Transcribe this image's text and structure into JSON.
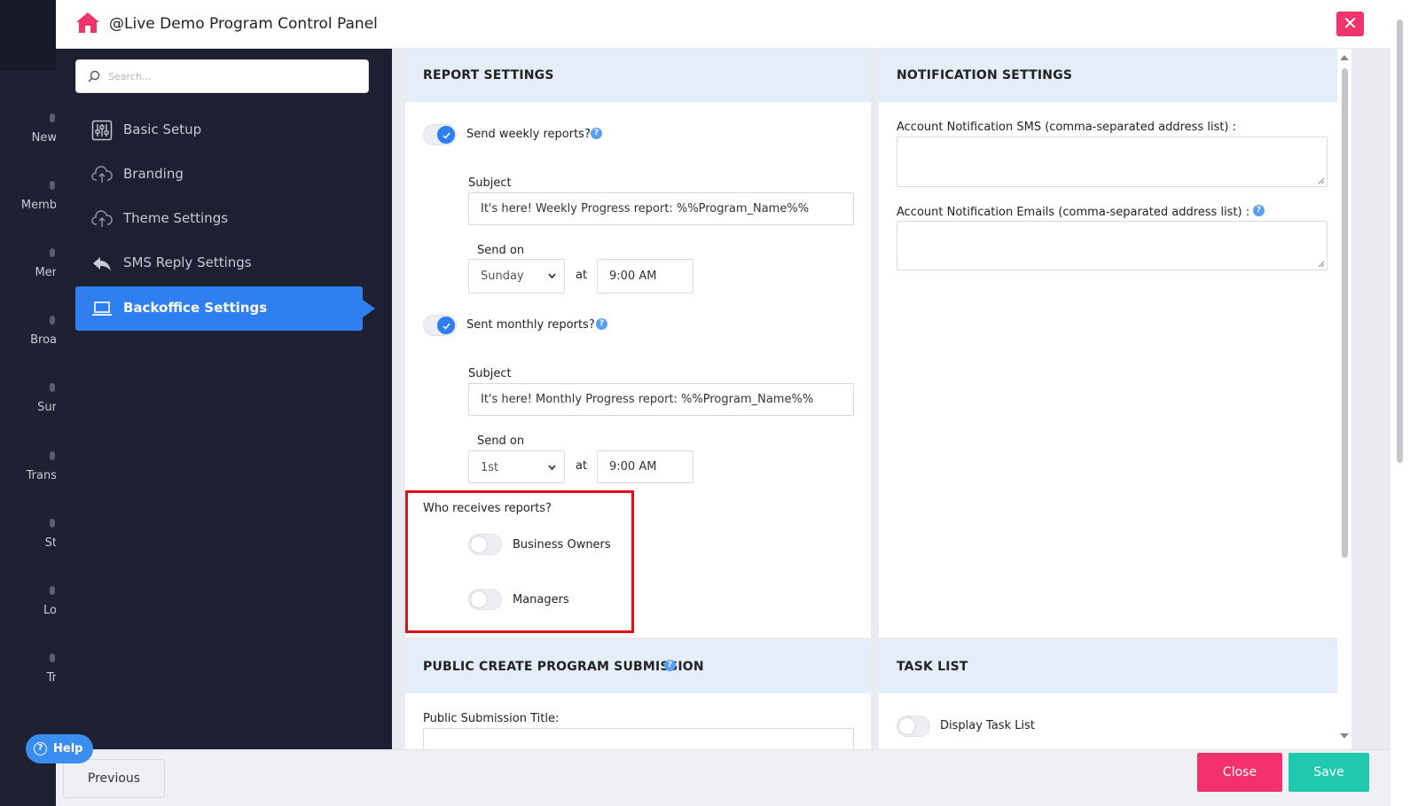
{
  "background_nav": {
    "items": [
      "New",
      "Memb",
      "Mer",
      "Broa",
      "Sur",
      "Trans",
      "St",
      "Lo",
      "Tr"
    ]
  },
  "header": {
    "title": "@Live Demo Program Control Panel",
    "close_symbol": "✕"
  },
  "nav": {
    "search_placeholder": "Search...",
    "items": [
      {
        "label": "Basic Setup",
        "icon": "sliders-icon"
      },
      {
        "label": "Branding",
        "icon": "cloud-upload-icon"
      },
      {
        "label": "Theme Settings",
        "icon": "cloud-upload-icon"
      },
      {
        "label": "SMS Reply Settings",
        "icon": "reply-all-icon"
      },
      {
        "label": "Backoffice Settings",
        "icon": "laptop-icon",
        "active": true
      }
    ]
  },
  "report_settings": {
    "title": "REPORT SETTINGS",
    "weekly": {
      "toggle_label": "Send weekly reports?",
      "enabled": true,
      "subject_label": "Subject",
      "subject_value": "It's here! Weekly Progress report: %%Program_Name%%",
      "send_on_label": "Send on",
      "day": "Sunday",
      "at_label": "at",
      "time": "9:00 AM"
    },
    "monthly": {
      "toggle_label": "Sent monthly reports?",
      "enabled": true,
      "subject_label": "Subject",
      "subject_value": "It's here! Monthly Progress report: %%Program_Name%%",
      "send_on_label": "Send on",
      "day": "1st",
      "at_label": "at",
      "time": "9:00 AM"
    },
    "recipients": {
      "label": "Who receives reports?",
      "options": [
        {
          "label": "Business Owners",
          "enabled": false
        },
        {
          "label": "Managers",
          "enabled": false
        }
      ]
    }
  },
  "notification_settings": {
    "title": "NOTIFICATION SETTINGS",
    "sms_label": "Account Notification SMS (comma-separated address list) :",
    "sms_value": "",
    "email_label": "Account Notification Emails (comma-separated address list) :",
    "email_value": ""
  },
  "public_submission": {
    "title": "PUBLIC CREATE PROGRAM SUBMISSION",
    "title_label": "Public Submission Title:"
  },
  "task_list": {
    "title": "TASK LIST",
    "display_label": "Display Task List",
    "enabled": false
  },
  "help_symbol": "?",
  "footer": {
    "previous": "Previous",
    "close": "Close",
    "save": "Save",
    "help": "Help"
  },
  "colors": {
    "accent": "#2f7ff0",
    "close": "#f2306e",
    "save": "#20c9ad",
    "highlight": "#e0101a"
  }
}
